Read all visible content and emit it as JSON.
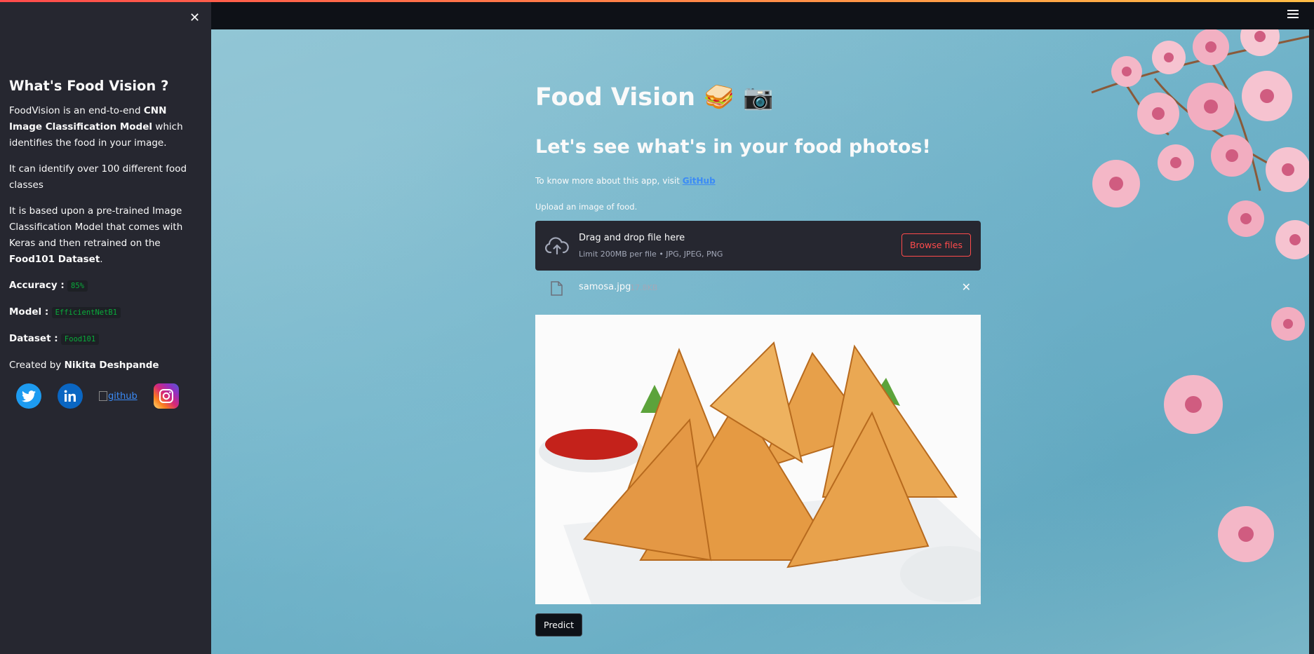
{
  "sidebar": {
    "close_icon": "close-icon",
    "title": "What's Food Vision ?",
    "p1_pre": "FoodVision is an end-to-end ",
    "p1_bold": "CNN Image Classification Model",
    "p1_post": " which identifies the food in your image.",
    "p2": "It can identify over 100 different food classes",
    "p3_pre": "It is based upon a pre-trained Image Classification Model that comes with Keras and then retrained on the ",
    "p3_bold": "Food101 Dataset",
    "p3_post": ".",
    "accuracy_label": "Accuracy :",
    "accuracy_value": "85%",
    "model_label": "Model :",
    "model_value": "EfficientNetB1",
    "dataset_label": "Dataset :",
    "dataset_value": "Food101",
    "created_pre": "Created by ",
    "created_name": "Nikita Deshpande",
    "socials": {
      "twitter": "twitter-icon",
      "linkedin": "linkedin-icon",
      "github_alt": "github",
      "instagram": "instagram-icon"
    }
  },
  "header": {
    "menu_icon": "hamburger-menu-icon"
  },
  "main": {
    "title": "Food Vision 🥪 📷",
    "subtitle": "Let's see what's in your food photos!",
    "info_pre": "To know more about this app, visit ",
    "info_link": "GitHub",
    "upload_label": "Upload an image of food.",
    "dropzone": {
      "title": "Drag and drop file here",
      "limit": "Limit 200MB per file • JPG, JPEG, PNG",
      "browse_label": "Browse files"
    },
    "file": {
      "name": "samosa.jpg",
      "size": "17.8KB"
    },
    "predict_label": "Predict"
  },
  "colors": {
    "accent": "#ff4b4b",
    "link": "#3b8bf6",
    "code": "#09ab3b",
    "sidebar_bg": "#262730"
  }
}
